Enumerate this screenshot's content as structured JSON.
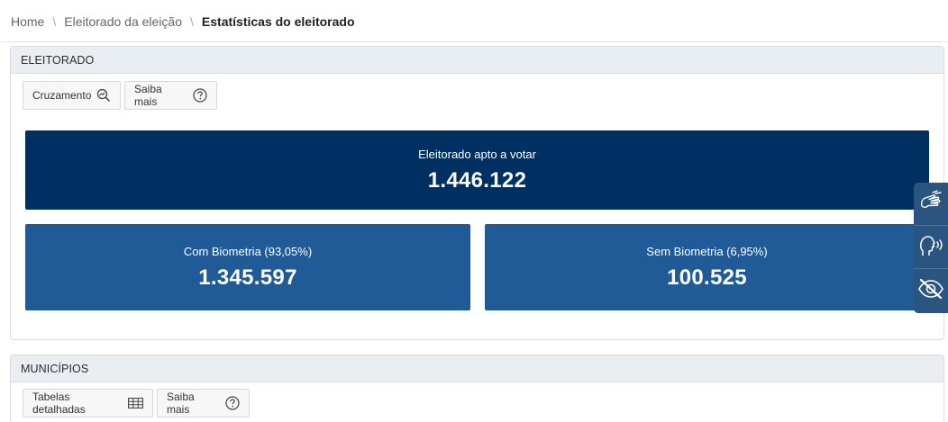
{
  "breadcrumb": {
    "items": [
      "Home",
      "Eleitorado da eleição"
    ],
    "current": "Estatísticas do eleitorado"
  },
  "eleitorado": {
    "title": "ELEITORADO",
    "buttons": {
      "cruzamento": "Cruzamento",
      "saiba_mais": "Saiba mais"
    },
    "apto": {
      "label": "Eleitorado apto a votar",
      "value": "1.446.122"
    },
    "com_biometria": {
      "label": "Com Biometria (93,05%)",
      "value": "1.345.597"
    },
    "sem_biometria": {
      "label": "Sem Biometria (6,95%)",
      "value": "100.525"
    }
  },
  "municipios": {
    "title": "MUNICÍPIOS",
    "buttons": {
      "tabelas": "Tabelas detalhadas",
      "saiba_mais": "Saiba mais"
    }
  },
  "accessibility": {
    "icons": [
      "sign-language-icon",
      "audio-reader-icon",
      "low-vision-icon"
    ]
  },
  "colors": {
    "apto_bg": "#002f62",
    "biometria_bg": "#205a97",
    "a11y_bg": "#2b5581",
    "header_bg": "#e9eef3"
  }
}
